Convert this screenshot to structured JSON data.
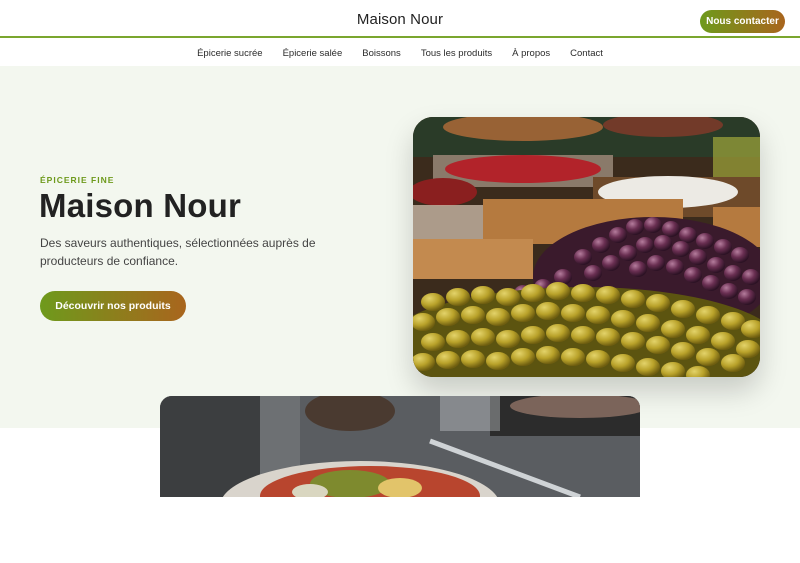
{
  "header": {
    "brand": "Maison Nour",
    "contact_label": "Nous contacter"
  },
  "nav": {
    "items": [
      {
        "label": "Épicerie sucrée"
      },
      {
        "label": "Épicerie salée"
      },
      {
        "label": "Boissons"
      },
      {
        "label": "Tous les produits"
      },
      {
        "label": "À propos"
      },
      {
        "label": "Contact"
      }
    ]
  },
  "hero": {
    "eyebrow": "ÉPICERIE FINE",
    "title": "Maison Nour",
    "subtitle": "Des saveurs authentiques, sélectionnées auprès de producteurs de confiance.",
    "cta_label": "Découvrir nos produits"
  },
  "colors": {
    "accent_green": "#6e9a1c",
    "accent_brown": "#a9651d",
    "hero_bg": "#f3f7ef"
  }
}
